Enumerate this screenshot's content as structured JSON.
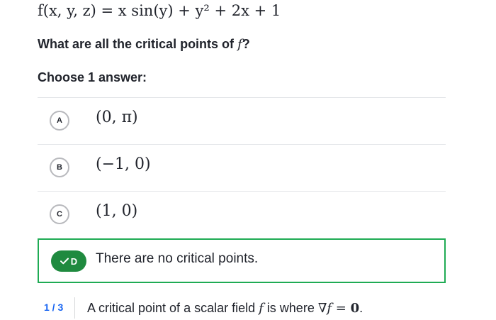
{
  "problem": {
    "function": "f(x, y, z) = x sin(y) + y² + 2x + 1",
    "question_prefix": "What are all the critical points of ",
    "question_var": "f",
    "question_suffix": "?",
    "instruction": "Choose 1 answer:"
  },
  "choices": [
    {
      "letter": "A",
      "text": "(0, π)",
      "selected": false
    },
    {
      "letter": "B",
      "text": "(−1, 0)",
      "selected": false
    },
    {
      "letter": "C",
      "text": "(1, 0)",
      "selected": false
    },
    {
      "letter": "D",
      "text": "There are no critical points.",
      "selected": true
    }
  ],
  "hint": {
    "counter": "1 / 3",
    "text_prefix": "A critical point of a scalar field ",
    "text_var": "f",
    "text_mid": " is where ",
    "text_nabla": "∇",
    "text_var2": "f",
    "text_eq": " = ",
    "text_zero": "0",
    "text_end": "."
  },
  "colors": {
    "correct_border": "#1fab54",
    "correct_pill": "#1f8a3f",
    "hint_counter": "#1865f2",
    "divider": "#e3e5e8"
  },
  "icons": {
    "check": "check-icon"
  }
}
